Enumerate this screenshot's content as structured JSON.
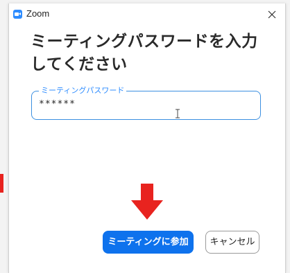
{
  "window": {
    "title": "Zoom",
    "app_icon": "zoom-camera-icon",
    "close_icon": "close-icon"
  },
  "dialog": {
    "heading": "ミーティングパスワードを入力してください"
  },
  "password_field": {
    "label": "ミーティングパスワード",
    "value": "******",
    "cursor_icon": "text-cursor-icon"
  },
  "annotation": {
    "arrow_icon": "down-arrow-icon",
    "arrow_color": "#e8231f"
  },
  "buttons": {
    "join_label": "ミーティングに参加",
    "cancel_label": "キャンセル"
  },
  "colors": {
    "accent": "#0e72ed",
    "field_border": "#3b8fe0",
    "label": "#2d8cff"
  }
}
